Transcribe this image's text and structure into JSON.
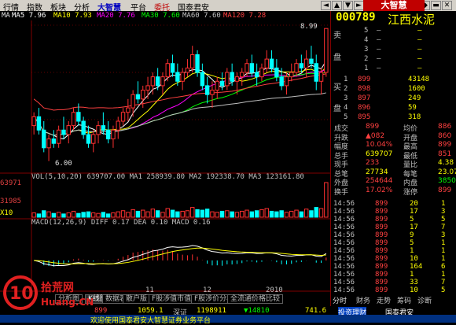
{
  "menu": [
    "行情",
    "指数",
    "板块",
    "分析",
    "大智慧",
    "平台",
    "委托",
    "国泰君安"
  ],
  "logo": "大智慧",
  "window_buttons": [
    "◄",
    "▲",
    "▼",
    "►",
    "▤",
    "◆",
    "▬",
    "✕"
  ],
  "chart_header": {
    "period": "日线",
    "ma_legend": [
      {
        "label": "MA",
        "color": "#e0e0e0"
      },
      {
        "label": "MA5",
        "value": "7.96",
        "color": "#ffffff"
      },
      {
        "label": "MA10",
        "value": "7.93",
        "color": "#ffff00"
      },
      {
        "label": "MA20",
        "value": "7.76",
        "color": "#ff00ff"
      },
      {
        "label": "MA30",
        "value": "7.60",
        "color": "#00ff00"
      },
      {
        "label": "MA60",
        "value": "7.60",
        "color": "#c0c0c0"
      },
      {
        "label": "MA120",
        "value": "7.28",
        "color": "#ff4040"
      }
    ]
  },
  "price_axis": [
    "899",
    "800",
    "700"
  ],
  "price_annotations": {
    "high": "8.99",
    "low": "6.00"
  },
  "vol_header": "VOL(5,10,20)  639707.00  MA1 258939.80  MA2 192338.70  MA3 123161.80",
  "vol_axis": [
    "63971",
    "31985",
    "X10"
  ],
  "macd_header": "MACD(12,26,9)  DIFF 0.17  DEA 0.10  MACD 0.16",
  "date_labels": [
    "11",
    "12",
    "2010"
  ],
  "chart_data": {
    "type": "candlestick",
    "title": "",
    "ylim": [
      5.8,
      9.1
    ],
    "candles": [
      [
        6.8,
        7.1,
        6.6,
        7.0
      ],
      [
        7.0,
        7.2,
        6.6,
        6.7
      ],
      [
        6.7,
        6.9,
        6.2,
        6.3
      ],
      [
        6.3,
        6.6,
        6.0,
        6.5
      ],
      [
        6.5,
        6.7,
        6.3,
        6.4
      ],
      [
        6.4,
        6.8,
        6.3,
        6.7
      ],
      [
        6.7,
        7.0,
        6.5,
        6.6
      ],
      [
        6.6,
        6.9,
        6.4,
        6.8
      ],
      [
        6.8,
        7.2,
        6.7,
        7.1
      ],
      [
        7.1,
        7.3,
        6.8,
        6.9
      ],
      [
        6.9,
        7.0,
        6.5,
        6.6
      ],
      [
        6.6,
        6.8,
        6.3,
        6.4
      ],
      [
        6.4,
        6.7,
        6.2,
        6.6
      ],
      [
        6.6,
        6.9,
        6.4,
        6.8
      ],
      [
        6.8,
        7.1,
        6.6,
        6.7
      ],
      [
        6.7,
        6.9,
        6.4,
        6.5
      ],
      [
        6.5,
        6.8,
        6.3,
        6.7
      ],
      [
        6.7,
        7.0,
        6.5,
        6.9
      ],
      [
        6.9,
        7.2,
        6.8,
        7.1
      ],
      [
        7.1,
        7.4,
        6.9,
        7.2
      ],
      [
        7.2,
        7.6,
        7.0,
        7.5
      ],
      [
        7.5,
        7.8,
        7.3,
        7.4
      ],
      [
        7.4,
        7.7,
        7.2,
        7.6
      ],
      [
        7.6,
        7.9,
        7.4,
        7.7
      ],
      [
        7.7,
        8.0,
        7.5,
        7.9
      ],
      [
        7.9,
        8.1,
        7.6,
        7.7
      ],
      [
        7.7,
        8.0,
        7.5,
        7.9
      ],
      [
        7.9,
        8.3,
        7.8,
        8.2
      ],
      [
        8.2,
        8.4,
        7.9,
        8.0
      ],
      [
        8.0,
        8.2,
        7.7,
        7.8
      ],
      [
        7.8,
        8.1,
        7.6,
        8.0
      ],
      [
        8.0,
        8.3,
        7.9,
        8.1
      ],
      [
        8.1,
        8.6,
        8.0,
        8.4
      ],
      [
        8.4,
        8.5,
        7.9,
        8.0
      ],
      [
        8.0,
        8.2,
        7.6,
        7.7
      ],
      [
        7.7,
        7.9,
        7.3,
        7.5
      ],
      [
        7.5,
        7.8,
        7.2,
        7.6
      ],
      [
        7.6,
        7.9,
        7.4,
        7.8
      ],
      [
        7.8,
        8.0,
        7.6,
        7.7
      ],
      [
        7.7,
        8.1,
        7.6,
        8.0
      ],
      [
        8.0,
        8.2,
        7.7,
        7.8
      ],
      [
        7.8,
        8.0,
        7.5,
        7.9
      ],
      [
        7.9,
        8.1,
        7.7,
        8.0
      ],
      [
        8.0,
        8.3,
        7.9,
        8.2
      ],
      [
        8.2,
        8.4,
        7.9,
        8.0
      ],
      [
        8.0,
        8.2,
        7.7,
        7.9
      ],
      [
        7.9,
        8.2,
        7.8,
        8.1
      ],
      [
        8.1,
        8.5,
        8.0,
        8.3
      ],
      [
        8.3,
        8.5,
        8.0,
        8.1
      ],
      [
        8.1,
        8.3,
        7.8,
        7.9
      ],
      [
        7.9,
        8.1,
        7.6,
        7.7
      ],
      [
        7.7,
        8.0,
        7.5,
        7.9
      ],
      [
        7.9,
        8.2,
        7.8,
        8.0
      ],
      [
        8.0,
        8.3,
        7.9,
        8.2
      ],
      [
        8.2,
        8.4,
        8.0,
        8.1
      ],
      [
        8.1,
        8.5,
        7.9,
        8.3
      ],
      [
        8.3,
        8.6,
        8.1,
        8.2
      ],
      [
        8.2,
        8.4,
        7.6,
        7.8
      ],
      [
        7.8,
        8.1,
        7.5,
        8.0
      ],
      [
        8.0,
        8.99,
        7.9,
        8.99
      ]
    ],
    "volume_max": 63971,
    "volumes": [
      8,
      6,
      12,
      10,
      7,
      9,
      6,
      8,
      11,
      7,
      9,
      10,
      8,
      7,
      9,
      6,
      8,
      10,
      12,
      9,
      14,
      11,
      13,
      10,
      15,
      12,
      9,
      16,
      13,
      10,
      11,
      12,
      18,
      14,
      13,
      15,
      10,
      9,
      11,
      12,
      10,
      9,
      11,
      13,
      10,
      12,
      14,
      16,
      11,
      10,
      12,
      9,
      11,
      13,
      10,
      15,
      12,
      18,
      16,
      64
    ]
  },
  "quote": {
    "code": "000789",
    "name": "江西水泥",
    "sell_label": [
      "卖",
      "盘"
    ],
    "buy_label": [
      "买",
      "盘"
    ],
    "sell": [
      [
        "5",
        "—",
        "—"
      ],
      [
        "4",
        "—",
        "—"
      ],
      [
        "3",
        "—",
        "—"
      ],
      [
        "2",
        "—",
        "—"
      ],
      [
        "1",
        "—",
        "—"
      ]
    ],
    "buy": [
      [
        "1",
        "899",
        "43148"
      ],
      [
        "2",
        "898",
        "1600"
      ],
      [
        "3",
        "897",
        "249"
      ],
      [
        "4",
        "896",
        "59"
      ],
      [
        "5",
        "895",
        "318"
      ]
    ],
    "stats": [
      [
        "成交",
        "899",
        "均价",
        "886"
      ],
      [
        "升跌",
        "▲082",
        "开盘",
        "860"
      ],
      [
        "幅度",
        "10.04%",
        "最高",
        "899"
      ],
      [
        "总手",
        "639707",
        "最低",
        "851"
      ],
      [
        "现手",
        "233",
        "量比",
        "4.38"
      ],
      [
        "总笔",
        "27734",
        "每笔",
        "23.07"
      ],
      [
        "外盘",
        "254644",
        "内盘",
        "385063"
      ],
      [
        "换手",
        "17.02%",
        "涨停",
        "899"
      ]
    ],
    "ticks": [
      [
        "14:56",
        "899",
        "20",
        "1"
      ],
      [
        "14:56",
        "899",
        "17",
        "3"
      ],
      [
        "14:56",
        "899",
        "5",
        "5"
      ],
      [
        "14:56",
        "899",
        "17",
        "7"
      ],
      [
        "14:56",
        "899",
        "9",
        "3"
      ],
      [
        "14:56",
        "899",
        "5",
        "1"
      ],
      [
        "14:56",
        "899",
        "1",
        "1"
      ],
      [
        "14:56",
        "899",
        "10",
        "1"
      ],
      [
        "14:56",
        "899",
        "164",
        "6"
      ],
      [
        "14:56",
        "899",
        "1",
        "1"
      ],
      [
        "14:56",
        "899",
        "33",
        "7"
      ],
      [
        "14:56",
        "899",
        "10",
        "5"
      ]
    ],
    "right_tabs": [
      "分时",
      "财务",
      "走势",
      "筹码",
      "诊断"
    ]
  },
  "bottom_tabs": [
    "分析图",
    "K线图",
    "数据表",
    "散户版",
    "F股涉值市值",
    "F股涉价分析",
    "全流通价格比较"
  ],
  "status": {
    "index1": "899",
    "index2": "1059.1",
    "label_sz": "深证",
    "val_sz": "1198911",
    "val2": "▼14810",
    "val3": "741.6",
    "right_label": "投资理财",
    "right_label2": "国泰君安"
  },
  "scroll_text": "欢迎使用国泰君安大智慧证券业务平台",
  "watermark": {
    "brand": "拾荒网",
    "site": "Huang.CN"
  }
}
